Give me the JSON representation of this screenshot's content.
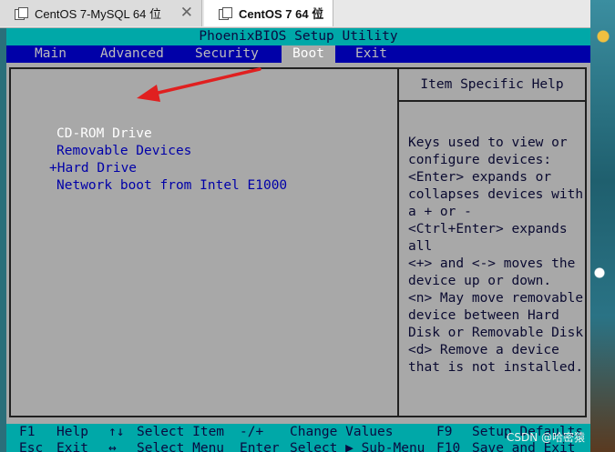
{
  "tabs": [
    {
      "label": "CentOS 7-MySQL 64 位",
      "close": "✕"
    },
    {
      "label": "CentOS 7 64 位",
      "close": "✕"
    }
  ],
  "bios": {
    "title": "PhoenixBIOS Setup Utility",
    "menu": [
      "Main",
      "Advanced",
      "Security",
      "Boot",
      "Exit"
    ],
    "active_menu": "Boot",
    "boot_items": [
      "CD-ROM Drive",
      "Removable Devices",
      "+Hard Drive",
      "Network boot from Intel E1000"
    ],
    "selected_boot_item": "CD-ROM Drive",
    "help_title": "Item Specific Help",
    "help_lines": [
      "Keys used to view or",
      "configure devices:",
      "<Enter> expands or",
      "collapses devices with",
      "a + or -",
      "<Ctrl+Enter> expands",
      "all",
      "<+> and <-> moves the",
      "device up or down.",
      "<n> May move removable",
      "device between Hard",
      "Disk or Removable Disk",
      "<d> Remove a device",
      "that is not installed."
    ],
    "footer": {
      "row1": [
        "F1",
        "Help",
        "↑↓",
        "Select Item",
        "-/+",
        "Change Values",
        "F9",
        "Setup Defaults"
      ],
      "row2": [
        "Esc",
        "Exit",
        "↔",
        "Select Menu",
        "Enter",
        "Select ▶ Sub-Menu",
        "F10",
        "Save and Exit"
      ]
    }
  },
  "watermark": "CSDN @哈密猿",
  "colors": {
    "bios_bg": "#a8a8a8",
    "menubar": "#0000a8",
    "title_bar": "#00a8a8",
    "arrow": "#e02020"
  }
}
